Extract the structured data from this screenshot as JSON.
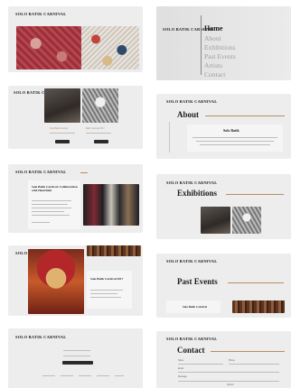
{
  "site": {
    "title": "SOLO BATIK CARNIVAL"
  },
  "menu": {
    "items": [
      "Home",
      "About",
      "Exhibitions",
      "Past Events",
      "Artists",
      "Contact"
    ]
  },
  "card2": {
    "caption_left": "Solo Batik Carnival",
    "caption_right": "Batik Carnival 2017",
    "btn_left": "View",
    "btn_right": "View"
  },
  "card3": {
    "heading": "Solo Batik Carnival: Collaboration with Heterfield"
  },
  "card4": {
    "heading": "Solo Batik Carnival 2017"
  },
  "about": {
    "heading": "About",
    "box_title": "Solo Batik"
  },
  "exhibitions": {
    "heading": "Exhibitions"
  },
  "past_events": {
    "heading": "Past Events",
    "item_label": "Solo Batik Carnival"
  },
  "contact": {
    "heading": "Contact",
    "labels": [
      "Name",
      "Email",
      "Message",
      "Phone"
    ],
    "submit": "Submit"
  },
  "colors": {
    "accent": "#b98d63",
    "card_bg": "#ededee",
    "dark": "#2b2b2b"
  },
  "icons": {
    "menu_divider": "vertical-line"
  }
}
